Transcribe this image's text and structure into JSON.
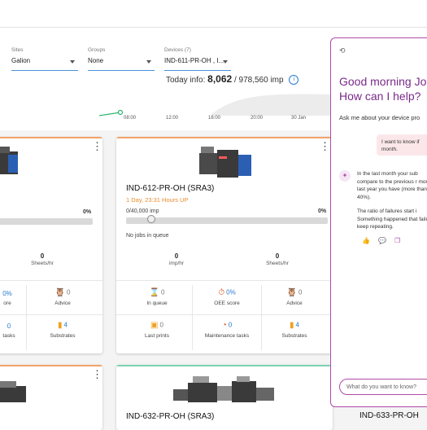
{
  "filters": {
    "sites": {
      "label": "Sites",
      "value": "Galion"
    },
    "groups": {
      "label": "Groups",
      "value": "None"
    },
    "devices": {
      "label": "Devices (7)",
      "value": "IND-611-PR-OH , I..."
    }
  },
  "today": {
    "prefix": "Today info:",
    "value": "8,062",
    "suffix": "/ 978,560 imp"
  },
  "chart_ticks": [
    "08:00",
    "12:00",
    "16:00",
    "20:00",
    "30 Jan"
  ],
  "cards": [
    {
      "name": "",
      "sub": "",
      "progress_pct": "0%",
      "stat1_value": "0",
      "stat1_label": "Sheets/hr",
      "cells": [
        {
          "value": "0%",
          "label": "ore"
        },
        {
          "value": "0",
          "label": "Advice",
          "icon": "owl-icon"
        },
        {
          "value": "0",
          "label": "tasks"
        },
        {
          "value": "4",
          "label": "Substrates",
          "icon": "substrate-icon"
        }
      ]
    },
    {
      "name": "IND-612-PR-OH (SRA3)",
      "sub": "1 Day, 23:31 Hours UP",
      "progress_pct": "0%",
      "progress_text": "0/40,000 imp",
      "queue_text": "No jobs in queue",
      "stat1_value": "0",
      "stat1_label": "imp/hr",
      "stat2_value": "0",
      "stat2_label": "Sheets/hr",
      "cells": [
        {
          "value": "0",
          "label": "In queue",
          "icon": "hourglass-icon"
        },
        {
          "value": "0%",
          "label": "OEE score",
          "icon": "stopwatch-icon"
        },
        {
          "value": "0",
          "label": "Advice",
          "icon": "owl-icon"
        },
        {
          "value": "0",
          "label": "Last prints",
          "icon": "print-icon"
        },
        {
          "value": "0",
          "label": "Maintenance tasks",
          "icon": "gauge-icon"
        },
        {
          "value": "4",
          "label": "Substrates",
          "icon": "substrate-icon"
        }
      ]
    },
    {
      "name": "IND-632-PR-OH (SRA3)"
    },
    {
      "name": "IND-633-PR-OH"
    }
  ],
  "chat": {
    "greeting_line1": "Good morning Jo",
    "greeting_line2": "How can I help?",
    "ask": "Ask me about your device pro",
    "user_msg": "I want to know if month.",
    "bot_msg_1": "In the last month your sub compare to the previous r month last year you have (more than 40%).",
    "bot_msg_2": "The ratio of failures start i Something happened that failures keep repeating.",
    "input_placeholder": "What do you want to know?"
  },
  "colors": {
    "accent": "#b14aa8",
    "link": "#2b7bd0",
    "warning": "#e98c2c",
    "card_top_orange": "#f1a36a",
    "card_top_green": "#7fd3b0"
  }
}
